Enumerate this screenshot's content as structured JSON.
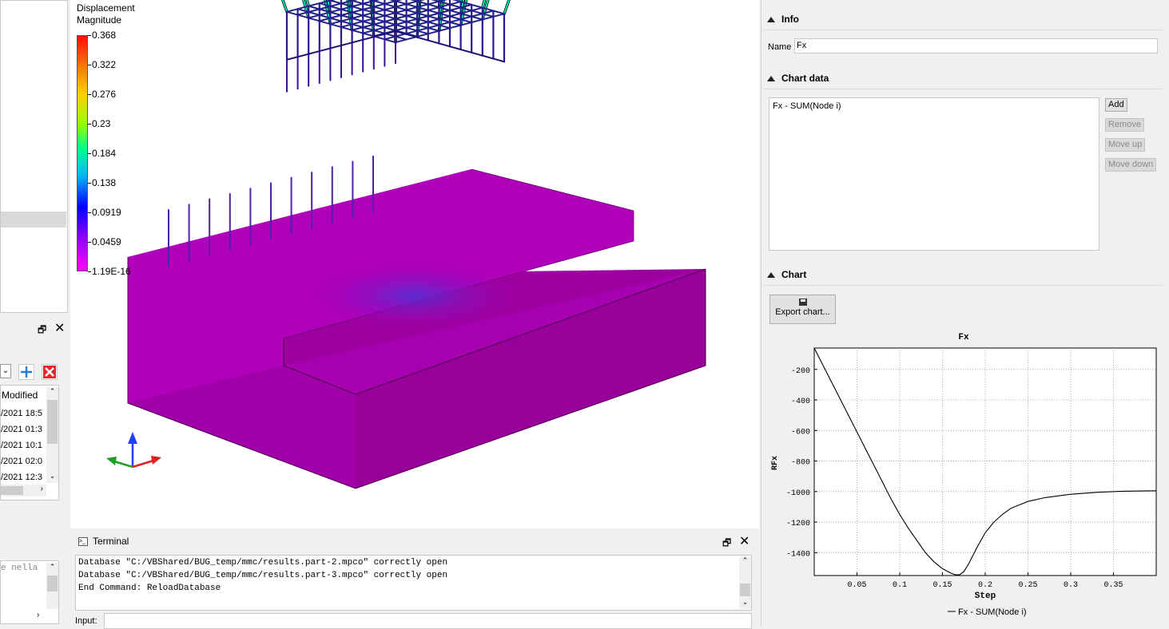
{
  "left_panel": {
    "column_header": "Modified",
    "dates": [
      "/2021 18:5",
      "/2021 01:3",
      "/2021 10:1",
      "/2021 02:0",
      "/2021 12:3"
    ],
    "notes_text": "e nella"
  },
  "viewport": {
    "legend_title": [
      "Displacement",
      "Magnitude"
    ],
    "legend_ticks": [
      "0.368",
      "0.322",
      "0.276",
      "0.23",
      "0.184",
      "0.138",
      "0.0919",
      "0.0459",
      "1.19E-16"
    ]
  },
  "terminal": {
    "title": "Terminal",
    "lines": [
      "Database \"C:/VBShared/BUG_temp/mmc/results.part-2.mpco\" correctly open",
      "Database \"C:/VBShared/BUG_temp/mmc/results.part-3.mpco\" correctly open",
      "End Command: ReloadDatabase"
    ],
    "input_label": "Input:"
  },
  "right_panel": {
    "info_label": "Info",
    "name_label": "Name",
    "name_value": "Fx",
    "chart_data_label": "Chart data",
    "chart_data_items": [
      "Fx - SUM(Node i)"
    ],
    "add_label": "Add",
    "remove_label": "Remove",
    "move_up_label": "Move up",
    "move_down_label": "Move down",
    "chart_label": "Chart",
    "export_label": "Export chart..."
  },
  "chart_data": {
    "type": "line",
    "title": "Fx",
    "xlabel": "Step",
    "ylabel": "RFx",
    "xlim": [
      0,
      0.4
    ],
    "ylim": [
      -1550,
      -60
    ],
    "xticks": [
      0.05,
      0.1,
      0.15,
      0.2,
      0.25,
      0.3,
      0.35
    ],
    "xtick_labels": [
      "0.05",
      "0.1",
      "0.15",
      "0.2",
      "0.25",
      "0.3",
      "0.35"
    ],
    "yticks": [
      -200,
      -400,
      -600,
      -800,
      -1000,
      -1200,
      -1400
    ],
    "ytick_labels": [
      "-200",
      "-400",
      "-600",
      "-800",
      "-1000",
      "-1200",
      "-1400"
    ],
    "grid": true,
    "legend_position": "bottom",
    "series": [
      {
        "name": "Fx - SUM(Node i)",
        "color": "#000000",
        "x": [
          0,
          0.01,
          0.02,
          0.03,
          0.04,
          0.05,
          0.06,
          0.07,
          0.08,
          0.09,
          0.1,
          0.11,
          0.12,
          0.13,
          0.14,
          0.15,
          0.16,
          0.165,
          0.17,
          0.175,
          0.18,
          0.19,
          0.2,
          0.21,
          0.22,
          0.23,
          0.25,
          0.27,
          0.3,
          0.33,
          0.36,
          0.4
        ],
        "y": [
          -60,
          -170,
          -280,
          -390,
          -500,
          -610,
          -720,
          -830,
          -940,
          -1050,
          -1150,
          -1240,
          -1320,
          -1400,
          -1460,
          -1505,
          -1535,
          -1545,
          -1545,
          -1525,
          -1480,
          -1370,
          -1270,
          -1200,
          -1150,
          -1110,
          -1065,
          -1040,
          -1018,
          -1005,
          -998,
          -995
        ]
      }
    ]
  },
  "colors": {
    "colormap": [
      "#ff00ff",
      "#8000ff",
      "#0000ff",
      "#00c0ff",
      "#00ff80",
      "#c0ff00",
      "#ffd000",
      "#ff7000",
      "#ff0000"
    ],
    "soil": "#b000b8",
    "axis_x": "#e02020",
    "axis_y": "#1f3fff",
    "axis_z": "#20a020"
  }
}
